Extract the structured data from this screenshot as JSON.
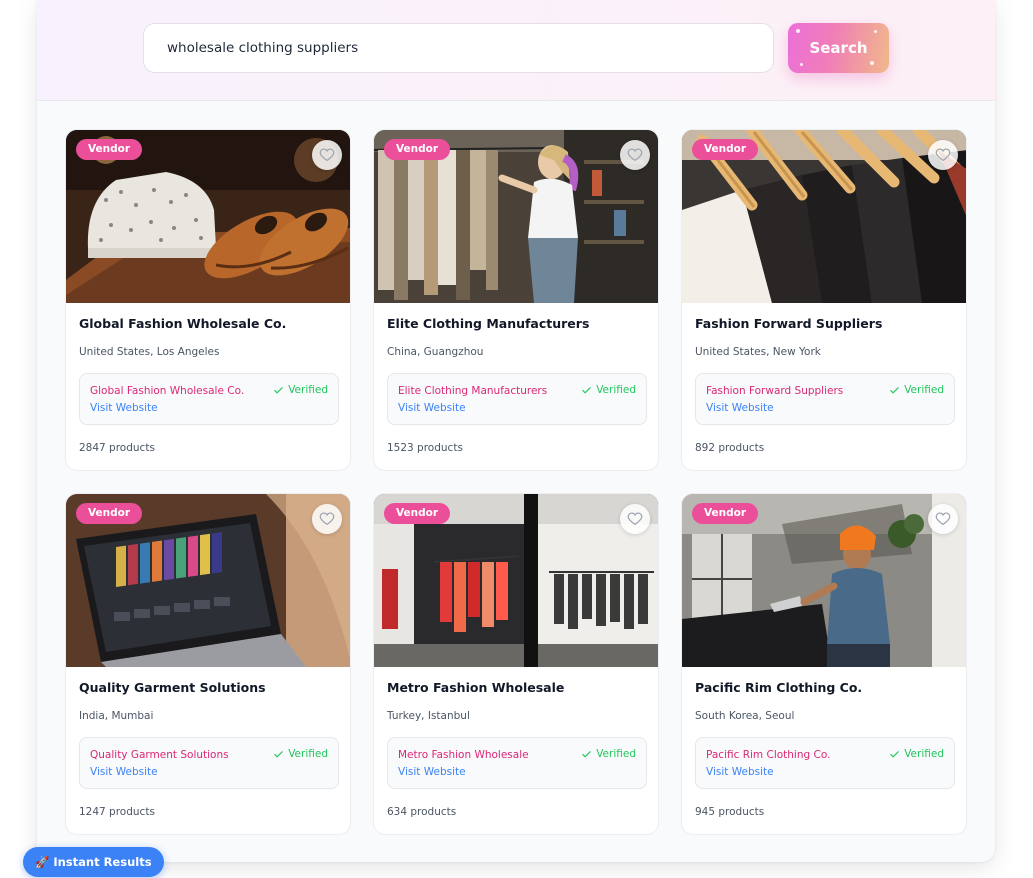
{
  "search": {
    "query": "wholesale clothing suppliers",
    "button_label": "Search"
  },
  "floating": {
    "instant_label": "🚀 Instant Results"
  },
  "colors": {
    "accent_pink": "#ec4f9a",
    "link_blue": "#3b82f6",
    "verified_green": "#22c55e"
  },
  "cards": [
    {
      "badge": "Vendor",
      "title": "Global Fashion Wholesale Co.",
      "location": "United States, Los Angeles",
      "vendor": "Global Fashion Wholesale Co.",
      "verified": "Verified",
      "link": "Visit Website",
      "count": "2847 products",
      "image": "shirts-and-shoes"
    },
    {
      "badge": "Vendor",
      "title": "Elite Clothing Manufacturers",
      "location": "China, Guangzhou",
      "vendor": "Elite Clothing Manufacturers",
      "verified": "Verified",
      "link": "Visit Website",
      "count": "1523 products",
      "image": "woman-browsing-rack"
    },
    {
      "badge": "Vendor",
      "title": "Fashion Forward Suppliers",
      "location": "United States, New York",
      "vendor": "Fashion Forward Suppliers",
      "verified": "Verified",
      "link": "Visit Website",
      "count": "892 products",
      "image": "wooden-hangers"
    },
    {
      "badge": "Vendor",
      "title": "Quality Garment Solutions",
      "location": "India, Mumbai",
      "vendor": "Quality Garment Solutions",
      "verified": "Verified",
      "link": "Visit Website",
      "count": "1247 products",
      "image": "laptop-clothing-catalog"
    },
    {
      "badge": "Vendor",
      "title": "Metro Fashion Wholesale",
      "location": "Turkey, Istanbul",
      "vendor": "Metro Fashion Wholesale",
      "verified": "Verified",
      "link": "Visit Website",
      "count": "634 products",
      "image": "boutique-interior"
    },
    {
      "badge": "Vendor",
      "title": "Pacific Rim Clothing Co.",
      "location": "South Korea, Seoul",
      "vendor": "Pacific Rim Clothing Co.",
      "verified": "Verified",
      "link": "Visit Website",
      "count": "945 products",
      "image": "man-working-laptop"
    }
  ]
}
